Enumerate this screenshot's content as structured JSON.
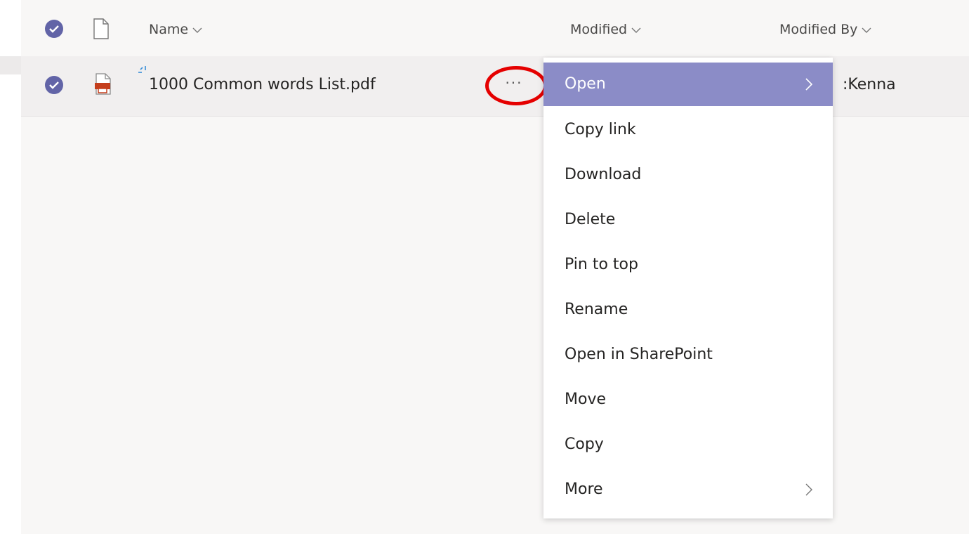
{
  "header": {
    "name_label": "Name",
    "modified_label": "Modified",
    "modified_by_label": "Modified By"
  },
  "file": {
    "name": "1000 Common words List.pdf",
    "modified_by": ":Kenna"
  },
  "more_options": "···",
  "menu": {
    "items": [
      {
        "label": "Open",
        "has_submenu": true,
        "active": true
      },
      {
        "label": "Copy link"
      },
      {
        "label": "Download"
      },
      {
        "label": "Delete"
      },
      {
        "label": "Pin to top"
      },
      {
        "label": "Rename"
      },
      {
        "label": "Open in SharePoint"
      },
      {
        "label": "Move"
      },
      {
        "label": "Copy"
      },
      {
        "label": "More",
        "has_submenu": true
      }
    ]
  },
  "colors": {
    "accent": "#6264a7",
    "menu_active": "#8b8cc7",
    "highlight_ring": "#e50000",
    "pdf_icon": "#c43e1c"
  }
}
